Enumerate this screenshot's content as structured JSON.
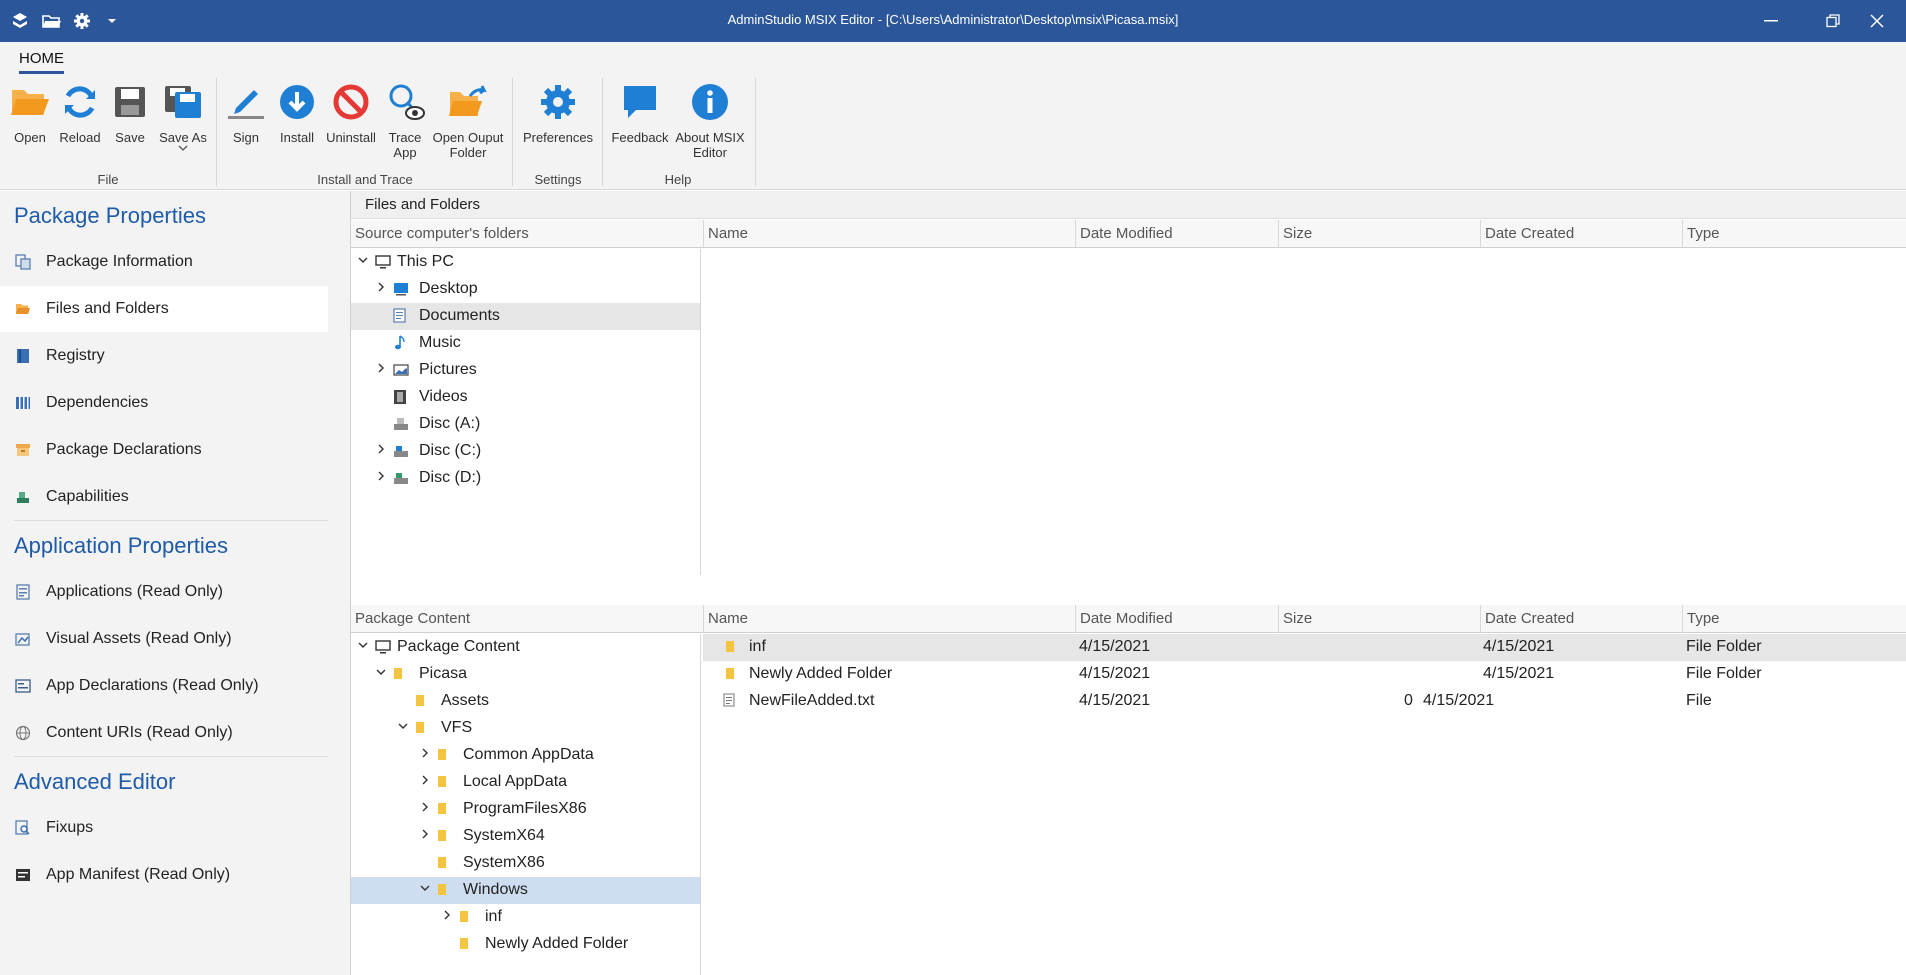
{
  "window": {
    "title": "AdminStudio MSIX Editor - [C:\\Users\\Administrator\\Desktop\\msix\\Picasa.msix]",
    "accent_color": "#2b579a"
  },
  "quick_access": [
    "app-logo-icon",
    "open-folder-icon",
    "gear-icon",
    "dropdown-icon"
  ],
  "ribbon": {
    "tab": "HOME",
    "groups": {
      "file": "File",
      "install_trace": "Install and Trace",
      "settings": "Settings",
      "help": "Help"
    },
    "buttons": {
      "open": "Open",
      "reload": "Reload",
      "save": "Save",
      "save_as": "Save As",
      "sign": "Sign",
      "install": "Install",
      "uninstall": "Uninstall",
      "trace_app_1": "Trace",
      "trace_app_2": "App",
      "open_output_1": "Open Ouput",
      "open_output_2": "Folder",
      "preferences": "Preferences",
      "feedback": "Feedback",
      "about_1": "About MSIX",
      "about_2": "Editor"
    }
  },
  "nav": {
    "package_properties": "Package Properties",
    "package_items": [
      "Package Information",
      "Files and Folders",
      "Registry",
      "Dependencies",
      "Package Declarations",
      "Capabilities"
    ],
    "application_properties": "Application Properties",
    "application_items": [
      "Applications (Read Only)",
      "Visual Assets (Read Only)",
      "App Declarations (Read Only)",
      "Content URIs (Read Only)"
    ],
    "advanced_editor": "Advanced Editor",
    "advanced_items": [
      "Fixups",
      "App Manifest (Read Only)"
    ]
  },
  "main": {
    "section_title": "Files and Folders",
    "source": {
      "tree_header": "Source computer's folders",
      "columns": [
        "Name",
        "Date Modified",
        "Size",
        "Date Created",
        "Type"
      ],
      "tree": [
        "This PC",
        "Desktop",
        "Documents",
        "Music",
        "Pictures",
        "Videos",
        "Disc (A:)",
        "Disc (C:)",
        "Disc (D:)"
      ]
    },
    "package": {
      "tree_header": "Package Content",
      "columns": [
        "Name",
        "Date Modified",
        "Size",
        "Date Created",
        "Type"
      ],
      "tree": [
        "Package Content",
        "Picasa",
        "Assets",
        "VFS",
        "Common AppData",
        "Local AppData",
        "ProgramFilesX86",
        "SystemX64",
        "SystemX86",
        "Windows",
        "inf",
        "Newly Added Folder"
      ],
      "files": [
        {
          "name": "inf",
          "modified": "4/15/2021",
          "size": "",
          "created": "4/15/2021",
          "type": "File Folder"
        },
        {
          "name": "Newly Added Folder",
          "modified": "4/15/2021",
          "size": "",
          "created": "4/15/2021",
          "type": "File Folder"
        },
        {
          "name": "NewFileAdded.txt",
          "modified": "4/15/2021",
          "size": "0",
          "created": "4/15/2021",
          "type": "File"
        }
      ]
    }
  }
}
